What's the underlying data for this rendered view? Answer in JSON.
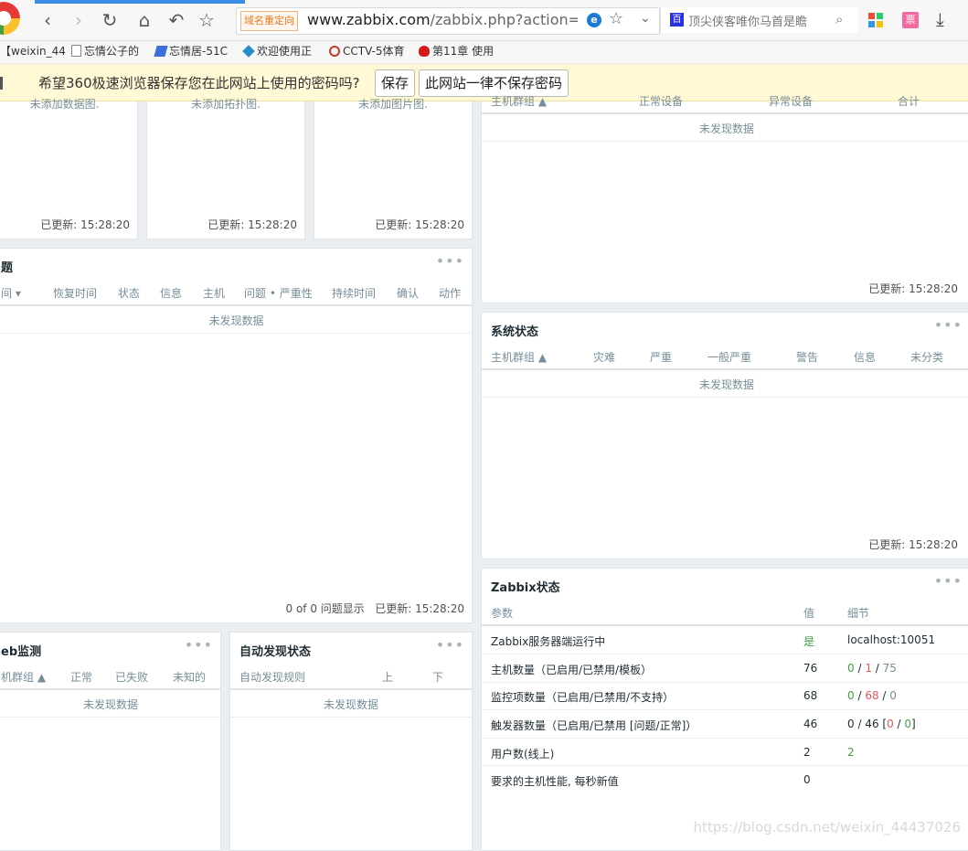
{
  "browser": {
    "domain_tag": "域名重定向",
    "url_host": "www.zabbix.com",
    "url_path": "/zabbix.php?action=das",
    "search_text": "顶尖侠客唯你马首是瞻",
    "ticket_label": "票",
    "ie_label": "e",
    "search_logo": "百"
  },
  "bookmarks": [
    {
      "label": "【weixin_44",
      "icon": "bracket"
    },
    {
      "label": "忘情公子的",
      "icon": "page-icon"
    },
    {
      "label": "忘情居-51C",
      "icon": "feather-icon"
    },
    {
      "label": "欢迎使用正",
      "icon": "box-icon"
    },
    {
      "label": "CCTV-5体育",
      "icon": "cctv-icon"
    },
    {
      "label": "第11章 使用",
      "icon": "redhat-icon"
    }
  ],
  "password_bar": {
    "message": "希望360极速浏览器保存您在此网站上使用的密码吗?",
    "save": "保存",
    "never": "此网站一律不保存密码"
  },
  "updated": "已更新: 15:28:20",
  "no_data": "未发现数据",
  "top_widgets": [
    {
      "cut_text": "未添加数据图."
    },
    {
      "cut_text": "未添加拓扑图."
    },
    {
      "cut_text": "未添加图片图."
    }
  ],
  "host_status": {
    "columns": [
      "主机群组 ▲",
      "正常设备",
      "异常设备",
      "合计"
    ]
  },
  "problems": {
    "title": "题",
    "columns": [
      "间 ▾",
      "恢复时间",
      "状态",
      "信息",
      "主机",
      "问题 • 严重性",
      "持续时间",
      "确认",
      "动作"
    ],
    "count": "0 of 0 问题显示"
  },
  "system_status": {
    "title": "系统状态",
    "columns": [
      "主机群组 ▲",
      "灾难",
      "严重",
      "一般严重",
      "警告",
      "信息",
      "未分类"
    ]
  },
  "web_monitoring": {
    "title": "eb监测",
    "columns": [
      "机群组 ▲",
      "正常",
      "已失败",
      "未知的"
    ]
  },
  "discovery": {
    "title": "自动发现状态",
    "columns": [
      "自动发现规则",
      "上",
      "下"
    ]
  },
  "zabbix_status": {
    "title": "Zabbix状态",
    "columns": [
      "参数",
      "值",
      "细节"
    ],
    "rows": [
      {
        "param": "Zabbix服务器端运行中",
        "value": "是",
        "detail_a": "localhost:10051",
        "detail_b": "",
        "detail_c": "",
        "detail_d": "",
        "detail_e": ""
      },
      {
        "param": "主机数量（已启用/已禁用/模板）",
        "value": "76",
        "detail_a": "0",
        "detail_b": " / ",
        "detail_c": "1",
        "detail_d": " / ",
        "detail_e": "75"
      },
      {
        "param": "监控项数量（已启用/已禁用/不支持）",
        "value": "68",
        "detail_a": "0",
        "detail_b": " / ",
        "detail_c": "68",
        "detail_d": " / ",
        "detail_e": "0"
      },
      {
        "param": "触发器数量（已启用/已禁用 [问题/正常]）",
        "value": "46",
        "detail_a": "0 / 46 [",
        "detail_b": "0",
        "detail_c": " / ",
        "detail_d": "0",
        "detail_e": "]"
      },
      {
        "param": "用户数(线上)",
        "value": "2",
        "detail_a": "2",
        "detail_b": "",
        "detail_c": "",
        "detail_d": "",
        "detail_e": ""
      },
      {
        "param": "要求的主机性能, 每秒新值",
        "value": "0",
        "detail_a": "",
        "detail_b": "",
        "detail_c": "",
        "detail_d": "",
        "detail_e": ""
      }
    ]
  },
  "watermark": "https://blog.csdn.net/weixin_44437026"
}
